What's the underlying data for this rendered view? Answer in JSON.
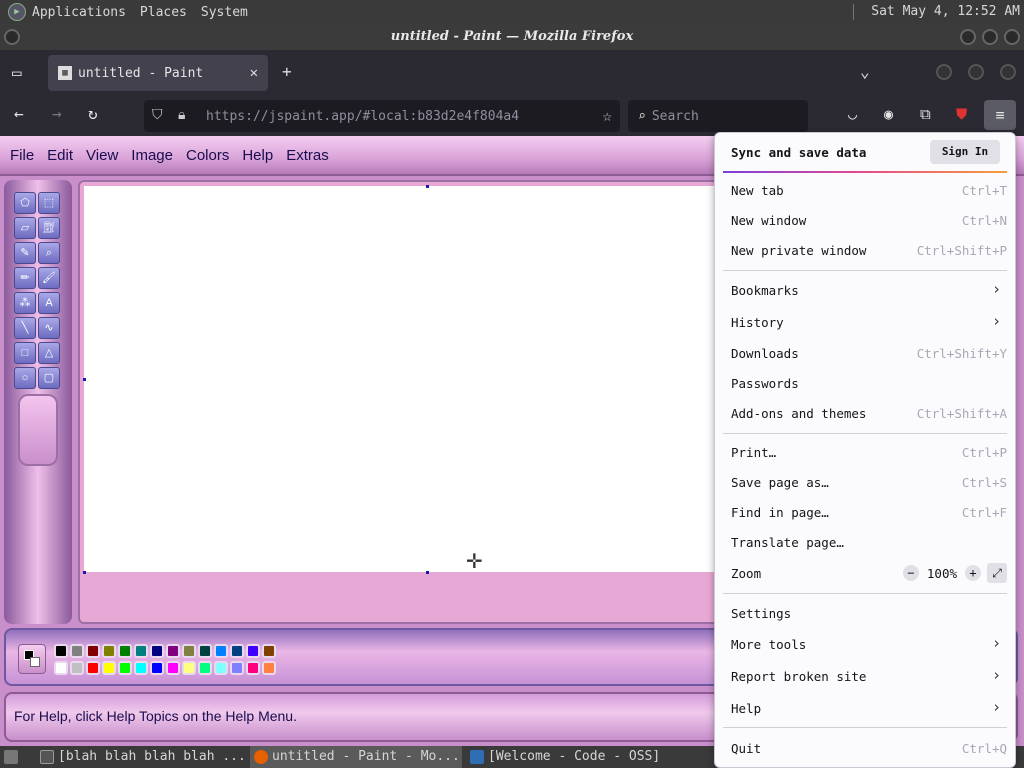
{
  "top_panel": {
    "menus": [
      "Applications",
      "Places",
      "System"
    ],
    "clock": "Sat May  4, 12:52 AM"
  },
  "window": {
    "title": "untitled - Paint — Mozilla Firefox"
  },
  "browser": {
    "tab_title": "untitled - Paint",
    "url": "https://jspaint.app/#local:b83d2e4f804a4",
    "search_placeholder": "Search"
  },
  "paint": {
    "menus": [
      "File",
      "Edit",
      "View",
      "Image",
      "Colors",
      "Help",
      "Extras"
    ],
    "status_text": "For Help, click Help Topics on the Help Menu.",
    "tools": [
      "free-form-select",
      "select",
      "eraser",
      "fill",
      "color-picker",
      "magnifier",
      "pencil",
      "brush",
      "airbrush",
      "text",
      "line",
      "curve",
      "rectangle",
      "polygon",
      "ellipse",
      "rounded-rectangle"
    ],
    "palette_top": [
      "#000000",
      "#808080",
      "#800000",
      "#808000",
      "#008000",
      "#008080",
      "#000080",
      "#800080",
      "#808040",
      "#004040",
      "#0080ff",
      "#004080",
      "#4000ff",
      "#804000"
    ],
    "palette_bottom": [
      "#ffffff",
      "#c0c0c0",
      "#ff0000",
      "#ffff00",
      "#00ff00",
      "#00ffff",
      "#0000ff",
      "#ff00ff",
      "#ffff80",
      "#00ff80",
      "#80ffff",
      "#8080ff",
      "#ff0080",
      "#ff8040"
    ]
  },
  "app_menu": {
    "sync_label": "Sync and save data",
    "sign_in": "Sign In",
    "items": {
      "new_tab": {
        "label": "New tab",
        "shortcut": "Ctrl+T"
      },
      "new_window": {
        "label": "New window",
        "shortcut": "Ctrl+N"
      },
      "new_private": {
        "label": "New private window",
        "shortcut": "Ctrl+Shift+P"
      },
      "bookmarks": {
        "label": "Bookmarks"
      },
      "history": {
        "label": "History"
      },
      "downloads": {
        "label": "Downloads",
        "shortcut": "Ctrl+Shift+Y"
      },
      "passwords": {
        "label": "Passwords"
      },
      "addons": {
        "label": "Add-ons and themes",
        "shortcut": "Ctrl+Shift+A"
      },
      "print": {
        "label": "Print…",
        "shortcut": "Ctrl+P"
      },
      "save_page": {
        "label": "Save page as…",
        "shortcut": "Ctrl+S"
      },
      "find": {
        "label": "Find in page…",
        "shortcut": "Ctrl+F"
      },
      "translate": {
        "label": "Translate page…"
      },
      "zoom": {
        "label": "Zoom",
        "value": "100%"
      },
      "settings": {
        "label": "Settings"
      },
      "more_tools": {
        "label": "More tools"
      },
      "report": {
        "label": "Report broken site"
      },
      "help": {
        "label": "Help"
      },
      "quit": {
        "label": "Quit",
        "shortcut": "Ctrl+Q"
      }
    }
  },
  "taskbar": {
    "tasks": [
      "[blah blah blah blah ...",
      "untitled - Paint - Mo...",
      "[Welcome - Code - OSS]"
    ]
  }
}
